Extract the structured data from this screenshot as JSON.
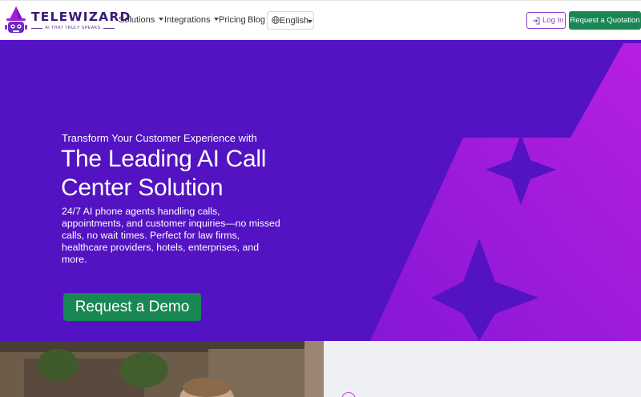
{
  "brand": {
    "name": "TELEWIZARD",
    "tagline": "AI THAT TRULY SPEAKS",
    "logo_icon": "wizard-robot-icon",
    "colors": {
      "primary": "#5313c3",
      "accent": "#a21fd6",
      "success": "#198754"
    }
  },
  "nav": {
    "items": [
      {
        "label": "Solutions",
        "dropdown": true
      },
      {
        "label": "Integrations",
        "dropdown": true
      },
      {
        "label": "Pricing",
        "dropdown": false
      },
      {
        "label": "Blog",
        "dropdown": false
      }
    ],
    "language": {
      "label": "English",
      "icon": "globe-icon"
    },
    "login": {
      "label": "Log In",
      "icon": "login-icon"
    },
    "quote_label": "Request a Quotation"
  },
  "hero": {
    "eyebrow": "Transform Your Customer Experience with",
    "headline": "The Leading AI Call Center Solution",
    "description": "24/7 AI phone agents handling calls, appointments, and customer inquiries—no missed calls, no wait times. Perfect for law firms, healthcare providers, hotels, enterprises, and more.",
    "cta_label": "Request a Demo"
  }
}
